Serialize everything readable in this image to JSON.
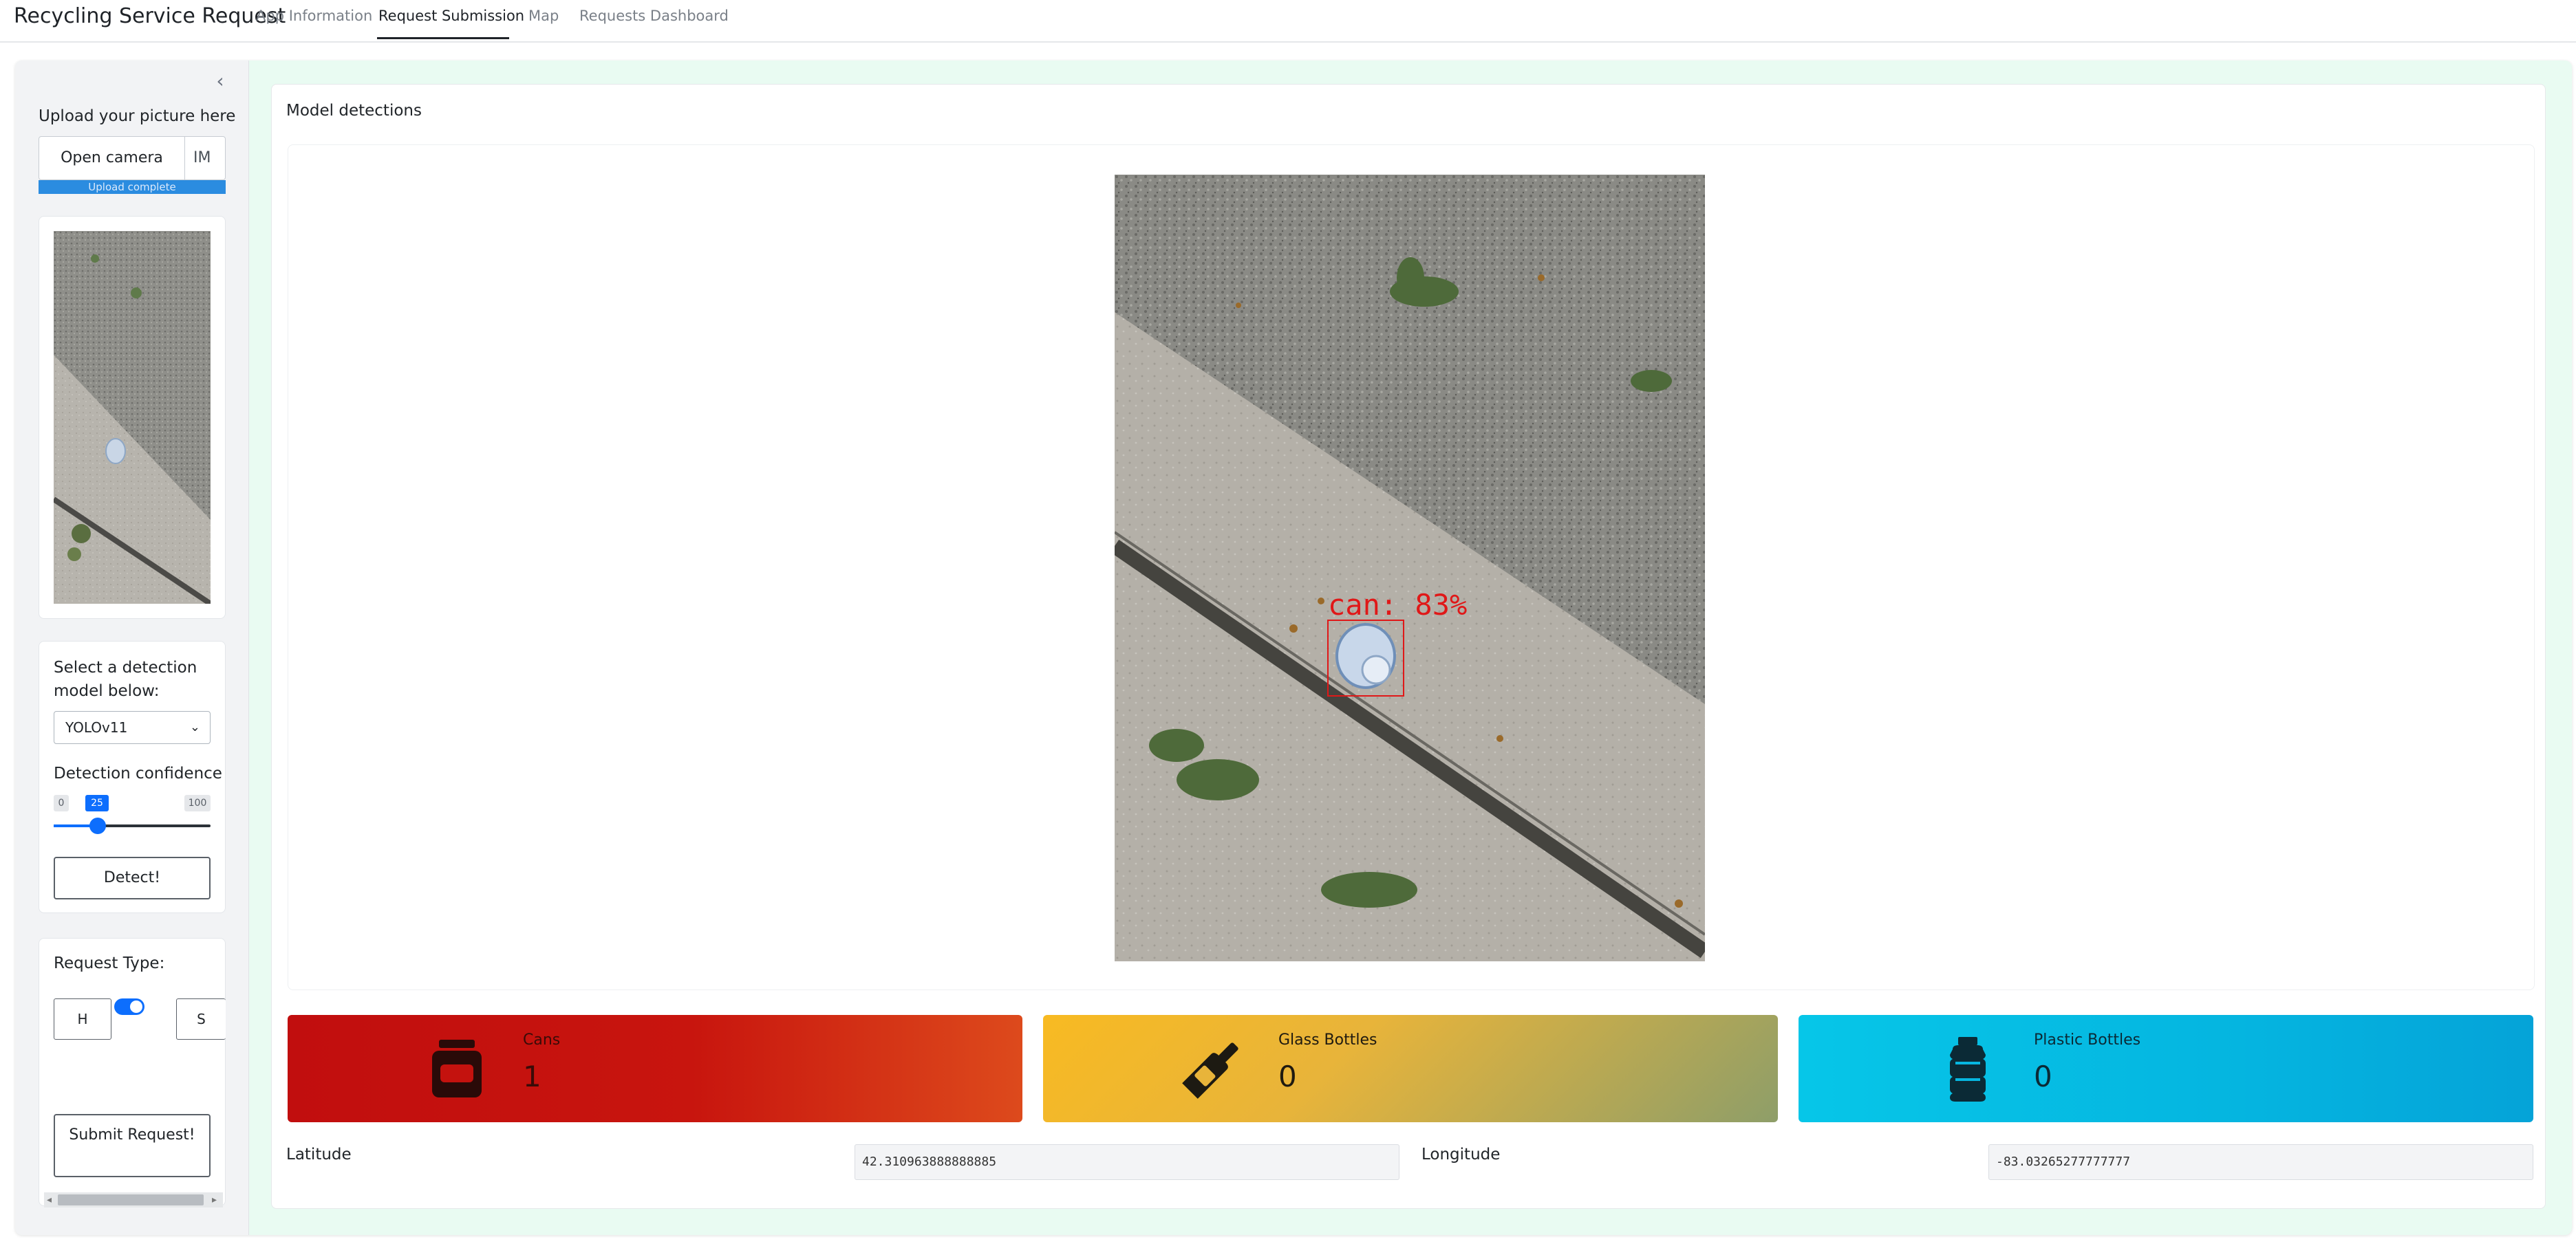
{
  "navbar": {
    "title": "Recycling Service Request",
    "tabs": [
      {
        "label": "App Information"
      },
      {
        "label": "Request Submission"
      },
      {
        "label": "Map"
      },
      {
        "label": "Requests Dashboard"
      }
    ],
    "active_tab": "Request Submission"
  },
  "sidebar": {
    "upload_label": "Upload your picture here",
    "upload_button": "Open camera",
    "upload_filename": "IM",
    "upload_status": "Upload complete",
    "model_label": "Select a detection model below:",
    "model_selected": "YOLOv11",
    "confidence_label": "Detection confidence",
    "confidence": {
      "min": "0",
      "value": "25",
      "max": "100"
    },
    "detect_button": "Detect!",
    "request_type_label": "Request Type:",
    "request_type_left": "H",
    "request_type_right": "S",
    "request_type_toggle_on": true,
    "submit_button": "Submit Request!"
  },
  "main": {
    "title": "Model detections",
    "detection_label": "can: 83%",
    "value_boxes": [
      {
        "title": "Cans",
        "value": "1",
        "icon": "jar-icon"
      },
      {
        "title": "Glass Bottles",
        "value": "0",
        "icon": "wine-bottle-icon"
      },
      {
        "title": "Plastic Bottles",
        "value": "0",
        "icon": "bottle-water-icon"
      }
    ],
    "latitude_label": "Latitude",
    "latitude_value": "42.310963888888885",
    "longitude_label": "Longitude",
    "longitude_value": "-83.03265277777777"
  },
  "colors": {
    "accent": "#0d6efd",
    "frame_bg": "#e9fbf2",
    "cans_gradient": [
      "#c10e0e",
      "#dd4a1c"
    ],
    "glass_gradient": [
      "#f6b926",
      "#8e9e69"
    ],
    "plastic_gradient": [
      "#06c6e8",
      "#05a3d8"
    ],
    "detection_box": "#e01818"
  }
}
